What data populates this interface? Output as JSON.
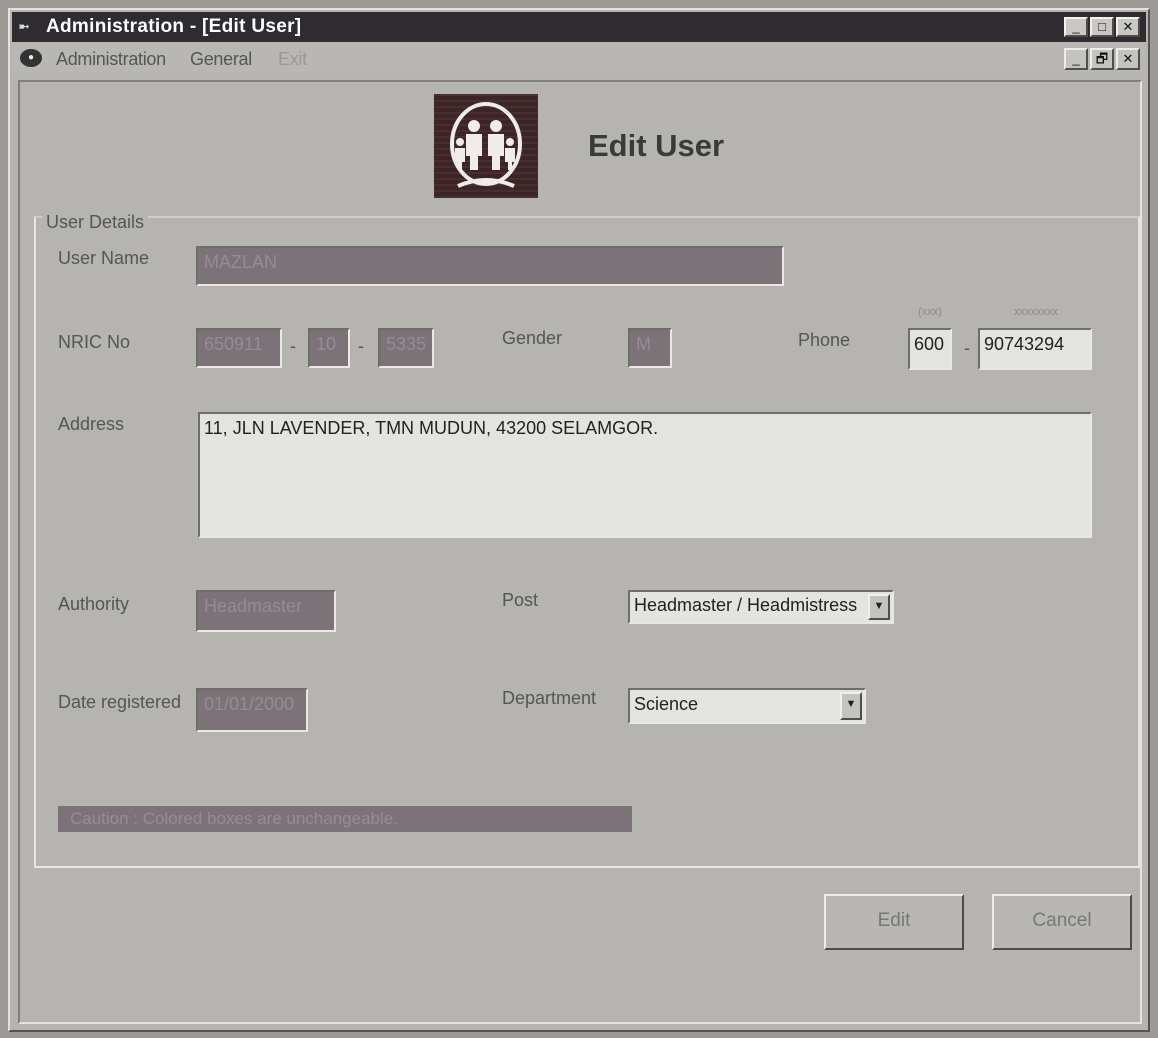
{
  "window": {
    "title": "Administration - [Edit User]",
    "system_icon": "dash-icon",
    "minimize": "_",
    "maximize": "□",
    "close": "✕"
  },
  "menu": {
    "items": [
      "Administration",
      "General",
      "Exit"
    ],
    "restore": "🗗"
  },
  "form": {
    "heading": "Edit User",
    "group_title": "User Details",
    "labels": {
      "user_name": "User Name",
      "nric": "NRIC No",
      "gender": "Gender",
      "phone": "Phone",
      "address": "Address",
      "authority": "Authority",
      "post": "Post",
      "date_registered": "Date registered",
      "department": "Department"
    },
    "values": {
      "user_name": "MAZLAN",
      "nric_part1": "650911",
      "nric_part2": "10",
      "nric_part3": "5335",
      "nric_sep1": "-",
      "nric_sep2": "-",
      "gender": "M",
      "phone_area": "600",
      "phone_sep": "-",
      "phone_number": "90743294",
      "address": "11, JLN LAVENDER, TMN MUDUN, 43200 SELAMGOR.",
      "authority": "Headmaster",
      "post": "Headmaster / Headmistress",
      "date_registered": "01/01/2000",
      "department": "Science"
    },
    "phone_hints": {
      "area": "(xxx)",
      "number": "xxxxxxxx"
    },
    "caution": "Caution : Colored boxes are unchangeable."
  },
  "buttons": {
    "edit": "Edit",
    "cancel": "Cancel"
  },
  "colors": {
    "face": "#b5b4b0",
    "titlebar": "#2e2c30",
    "locked_field": "#7b7378",
    "logo_bg": "#3d2426"
  }
}
